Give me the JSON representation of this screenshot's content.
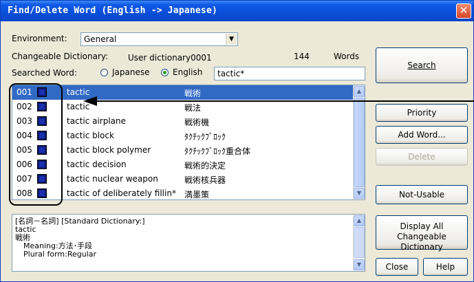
{
  "window": {
    "title": "Find/Delete Word (English -> Japanese)",
    "close_glyph": "✕"
  },
  "environment": {
    "label": "Environment:",
    "value": "General"
  },
  "changeable": {
    "label": "Changeable Dictionary:",
    "value": "User dictionary0001",
    "count": "144",
    "unit": "Words"
  },
  "searched": {
    "label": "Searched Word:",
    "radio_japanese": "Japanese",
    "radio_english": "English",
    "selected": "English",
    "value": "tactic*"
  },
  "results": [
    {
      "num": "001",
      "en": "tactic",
      "jp": "戦術",
      "selected": true
    },
    {
      "num": "002",
      "en": "tactic",
      "jp": "戦法",
      "selected": false
    },
    {
      "num": "003",
      "en": "tactic airplane",
      "jp": "戦術機",
      "selected": false
    },
    {
      "num": "004",
      "en": "tactic block",
      "jp": "ﾀｸﾁｯｸﾌﾞﾛｯｸ",
      "selected": false
    },
    {
      "num": "005",
      "en": "tactic block polymer",
      "jp": "ﾀｸﾁｯｸﾌﾞﾛｯｸ重合体",
      "selected": false
    },
    {
      "num": "006",
      "en": "tactic decision",
      "jp": "戦術的決定",
      "selected": false
    },
    {
      "num": "007",
      "en": "tactic nuclear weapon",
      "jp": "戦術核兵器",
      "selected": false
    },
    {
      "num": "008",
      "en": "tactic of deliberately fillin*",
      "jp": "満墨策",
      "selected": false
    }
  ],
  "details": {
    "header": "[名詞－名詞] [Standard Dictionary:]",
    "word": "tactic",
    "translation": "戦術",
    "meaning": "Meaning:方法･手段",
    "plural": "Plural form:Regular"
  },
  "buttons": {
    "search": "Search",
    "priority": "Priority",
    "add_word": "Add Word...",
    "delete": "Delete",
    "not_usable": "Not-Usable",
    "display_all_1": "Display All",
    "display_all_2": "Changeable Dictionary",
    "close": "Close",
    "help": "Help"
  },
  "colors": {
    "title_bar": "#0a4fd8",
    "selection": "#316ac5",
    "swatch": "#0a1a6e"
  }
}
